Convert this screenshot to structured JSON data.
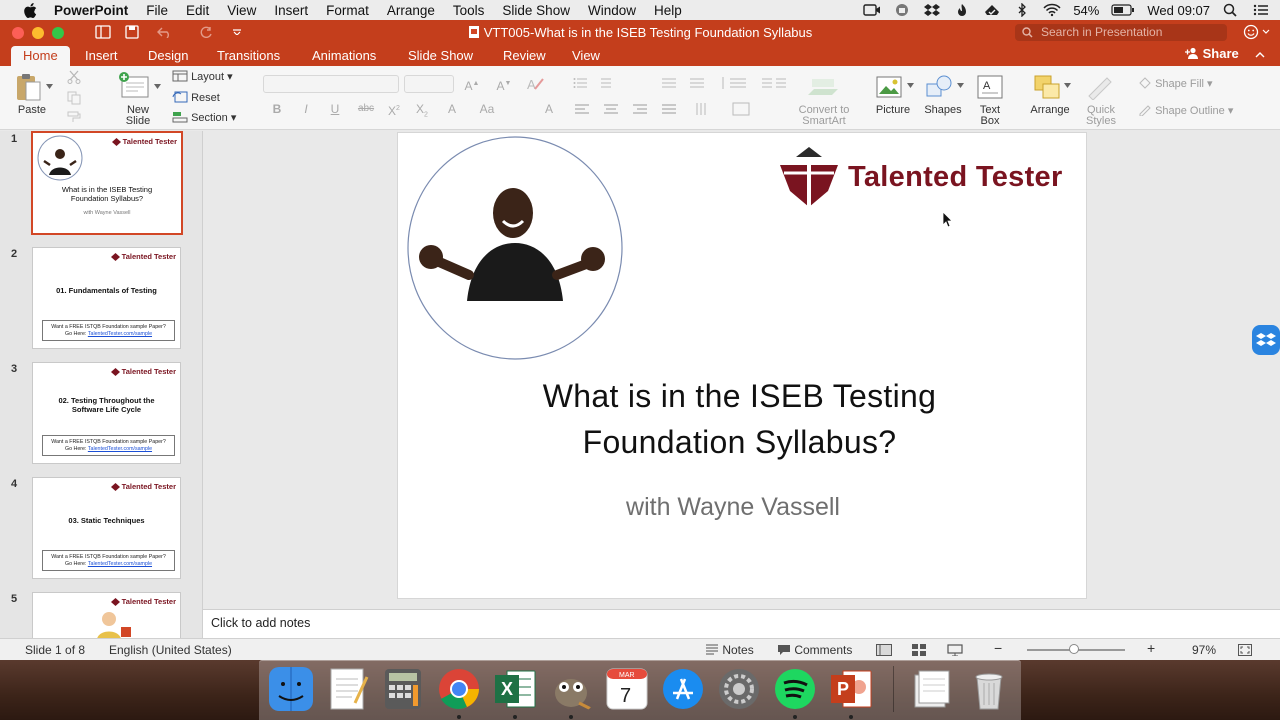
{
  "menubar": {
    "app_name": "PowerPoint",
    "items": [
      "File",
      "Edit",
      "View",
      "Insert",
      "Format",
      "Arrange",
      "Tools",
      "Slide Show",
      "Window",
      "Help"
    ],
    "battery": "54%",
    "clock": "Wed 09:07"
  },
  "window": {
    "title": "VTT005-What is in the ISEB Testing Foundation Syllabus",
    "search_placeholder": "Search in Presentation",
    "share_label": "Share"
  },
  "tabs": [
    "Home",
    "Insert",
    "Design",
    "Transitions",
    "Animations",
    "Slide Show",
    "Review",
    "View"
  ],
  "ribbon": {
    "paste": "Paste",
    "new_slide_1": "New",
    "new_slide_2": "Slide",
    "layout": "Layout",
    "reset": "Reset",
    "section": "Section",
    "convert_1": "Convert to",
    "convert_2": "SmartArt",
    "picture": "Picture",
    "shapes": "Shapes",
    "textbox_1": "Text",
    "textbox_2": "Box",
    "arrange": "Arrange",
    "quick_styles_1": "Quick",
    "quick_styles_2": "Styles",
    "shape_fill": "Shape Fill",
    "shape_outline": "Shape Outline"
  },
  "thumbnails": [
    {
      "num": "1",
      "title_1": "What is in the ISEB Testing",
      "title_2": "Foundation Syllabus?",
      "sub": "with Wayne Vassell",
      "logo": "Talented Tester"
    },
    {
      "num": "2",
      "title_1": "01. Fundamentals of Testing",
      "box_1": "Want a FREE ISTQB Foundation sample Paper?",
      "box_2": "Go Here:",
      "link": "TalentedTester.com/sample",
      "logo": "Talented Tester"
    },
    {
      "num": "3",
      "title_1": "02. Testing Throughout the",
      "title_2": "Software Life Cycle",
      "box_1": "Want a FREE ISTQB Foundation sample Paper?",
      "box_2": "Go Here:",
      "link": "TalentedTester.com/sample",
      "logo": "Talented Tester"
    },
    {
      "num": "4",
      "title_1": "03. Static Techniques",
      "box_1": "Want a FREE ISTQB Foundation sample Paper?",
      "box_2": "Go Here:",
      "link": "TalentedTester.com/sample",
      "logo": "Talented Tester"
    },
    {
      "num": "5",
      "logo": "Talented Tester"
    }
  ],
  "slide": {
    "logo": "Talented Tester",
    "title_1": "What is in the ISEB Testing",
    "title_2": "Foundation Syllabus?",
    "subtitle": "with Wayne Vassell"
  },
  "notes_placeholder": "Click to add notes",
  "status": {
    "slide_count": "Slide 1 of 8",
    "language": "English (United States)",
    "notes": "Notes",
    "comments": "Comments",
    "zoom": "97%"
  },
  "colors": {
    "accent": "#c43e1c",
    "brand": "#7a1420"
  }
}
